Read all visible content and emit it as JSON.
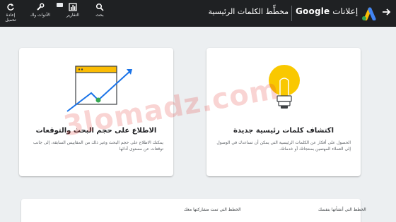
{
  "header": {
    "brand_google": "Google",
    "brand_product": "إعلانات",
    "page_title": "مخطِّط الكلمات الرئيسية"
  },
  "toolbar": {
    "search_label": "بحث",
    "reports_label": "التقارير",
    "tools_label": "الأدوات والـ",
    "refresh_label": "إعادة تحميل"
  },
  "cards": [
    {
      "title": "اكتشاف كلمات رئيسية جديدة",
      "description": "الحصول على أفكار عن الكلمات الرئيسية التي يمكن أن تساعدك في الوصول إلى العملاء المهتمين بمنتجاتك أو خدماتك."
    },
    {
      "title": "الاطلاع على حجم البحث والتوقعات",
      "description": "يمكنك الاطلاع على حجم البحث وغير ذلك من المقاييس السابقة، إلى جانب توقعات عن مستوى أدائها"
    }
  ],
  "bottom_tabs": {
    "created_by_you": "الخطط التي أنشأتها بنفسك",
    "shared_with_you": "الخطط التي تمت مشاركتها معك"
  },
  "watermark": "3lomadz.com",
  "colors": {
    "topbar": "#1f2123",
    "accent_blue": "#1a73e8",
    "bulb_yellow": "#f9c800",
    "chart_green": "#34a853"
  }
}
